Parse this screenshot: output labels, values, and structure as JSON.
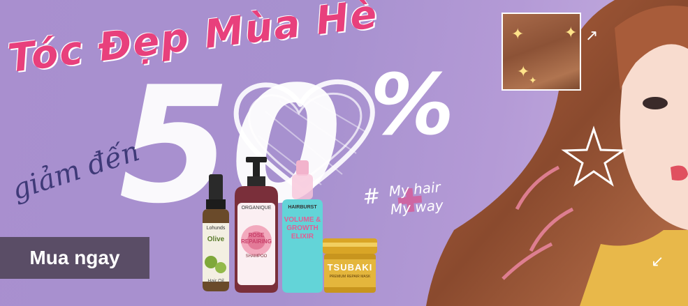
{
  "banner": {
    "headline": "Tóc Đẹp Mùa Hè",
    "reduce_label": "giảm đến",
    "discount_number": "50",
    "percent_sign": "%",
    "hashtag": {
      "hash": "#",
      "line1": "My hair",
      "line2": "My way"
    },
    "cta_label": "Mua ngay"
  },
  "products": {
    "olive_oil": {
      "brand": "Lohunds",
      "name": "Olive",
      "detail": "Hair Oil"
    },
    "organique": {
      "brand": "ORGANIQUE",
      "name": "ROSE REPAIRING",
      "detail": "SHAMPOO"
    },
    "hairburst": {
      "brand": "HAIRBURST",
      "name": "VOLUME & GROWTH ELIXIR"
    },
    "tsubaki": {
      "brand": "TSUBAKI",
      "detail": "PREMIUM REPAIR MASK"
    }
  },
  "colors": {
    "background": "#a98fcf",
    "headline": "#e8407c",
    "reduce_text": "#3f3a78",
    "cta_background": "#5a4d66",
    "cta_text": "#ffffff"
  },
  "icons": [
    "heart-doodle",
    "plus-icon",
    "sparkle-icon",
    "arrow-icon"
  ]
}
